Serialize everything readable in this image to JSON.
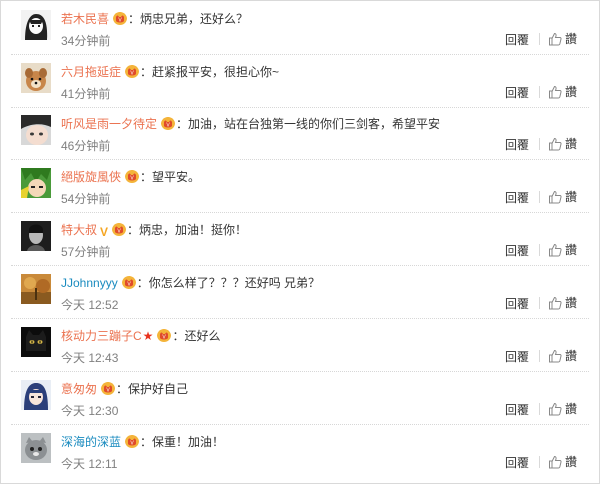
{
  "actions": {
    "reply_label": "回覆",
    "like_label": "讚"
  },
  "colors": {
    "username_orange": "#eb7350",
    "username_blue": "#1a8bbf",
    "vip_red": "#e04b2a"
  },
  "comments": [
    {
      "user": "若木民喜",
      "user_color": "orange",
      "badges": [
        "vip"
      ],
      "text": "炳忠兄弟，还好么？",
      "time": "34分钟前",
      "avatar": "anime-girl-avatar"
    },
    {
      "user": "六月拖延症",
      "user_color": "orange",
      "badges": [
        "vip"
      ],
      "text": "赶紧报平安，很担心你~",
      "time": "41分钟前",
      "avatar": "dog-avatar"
    },
    {
      "user": "听风是雨一夕待定",
      "user_color": "orange",
      "badges": [
        "vip"
      ],
      "text": "加油，站在台独第一线的你们三剑客，希望平安",
      "time": "46分钟前",
      "avatar": "anime-face-avatar"
    },
    {
      "user": "絕版旋風俠",
      "user_color": "orange",
      "badges": [
        "vip"
      ],
      "text": "望平安。",
      "time": "54分钟前",
      "avatar": "green-anime-avatar"
    },
    {
      "user": "特大叔",
      "user_color": "orange",
      "badges": [
        "v",
        "vip"
      ],
      "text": "炳忠，加油！挺你！",
      "time": "57分钟前",
      "avatar": "dark-portrait-avatar"
    },
    {
      "user": "JJohnnyyy",
      "user_color": "blue",
      "badges": [
        "vip"
      ],
      "text": "你怎么样了？？？还好吗 兄弟？",
      "time": "今天 12:52",
      "avatar": "autumn-avatar"
    },
    {
      "user": "核动力三蹦子C",
      "user_color": "orange",
      "badges": [
        "star",
        "vip"
      ],
      "text": "还好么",
      "time": "今天 12:43",
      "avatar": "black-cat-avatar"
    },
    {
      "user": "意匆匆",
      "user_color": "orange",
      "badges": [
        "vip"
      ],
      "text": "保护好自己",
      "time": "今天 12:30",
      "avatar": "blue-hair-avatar"
    },
    {
      "user": "深海的深蓝",
      "user_color": "blue",
      "badges": [
        "vip"
      ],
      "text": "保重！加油！",
      "time": "今天 12:11",
      "avatar": "grey-cat-avatar"
    }
  ]
}
